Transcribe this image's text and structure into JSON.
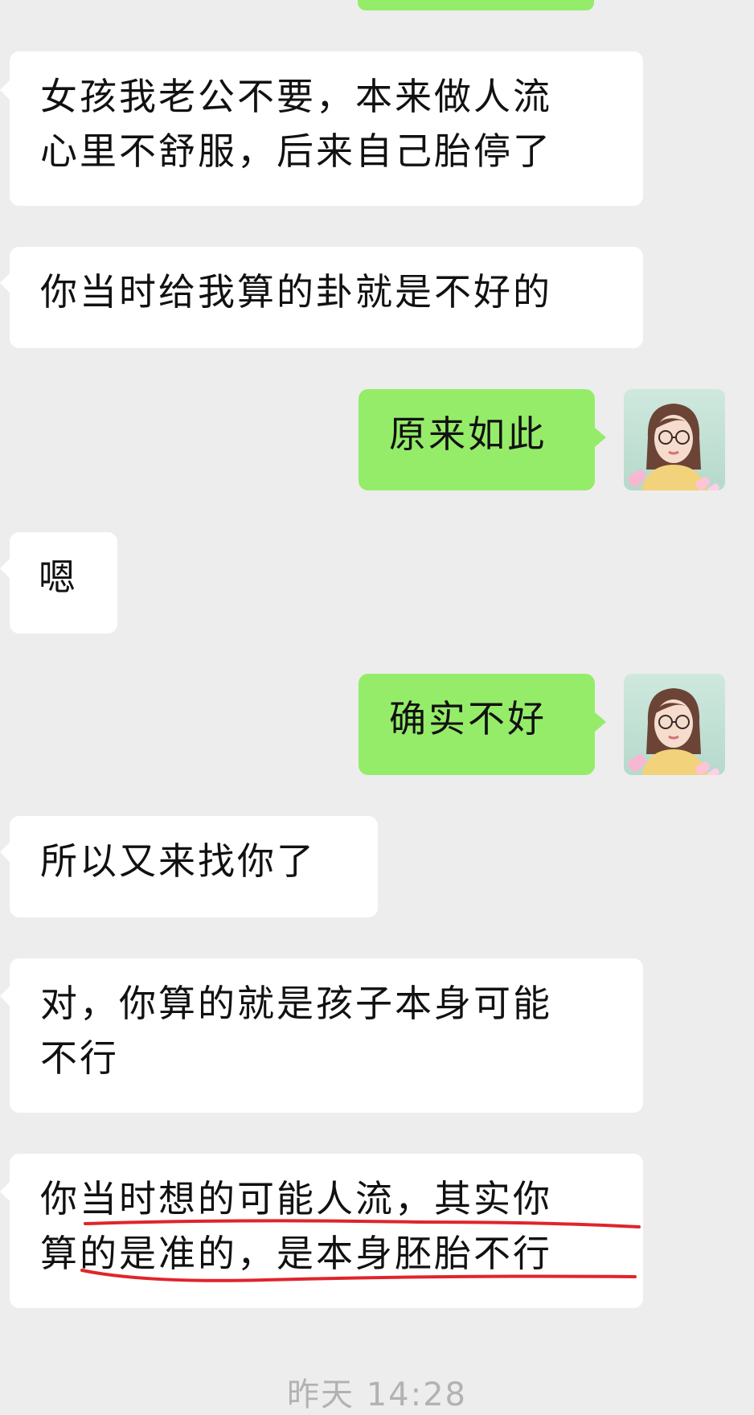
{
  "conversation": {
    "messages": [
      {
        "sender": "other",
        "text": "女孩我老公不要，本来做人流\n心里不舒服，后来自己胎停了"
      },
      {
        "sender": "other",
        "text": "你当时给我算的卦就是不好的"
      },
      {
        "sender": "me",
        "text": "原来如此"
      },
      {
        "sender": "other",
        "text": "嗯"
      },
      {
        "sender": "me",
        "text": "确实不好"
      },
      {
        "sender": "other",
        "text": "所以又来找你了"
      },
      {
        "sender": "other",
        "text": "对，你算的就是孩子本身可能\n不行"
      },
      {
        "sender": "other",
        "text": "你当时想的可能人流，其实你\n算的是准的，是本身胚胎不行"
      }
    ],
    "timestamp": "昨天 14:28"
  },
  "colors": {
    "background": "#ededed",
    "incoming_bubble": "#ffffff",
    "outgoing_bubble": "#95ec69",
    "annotation_underline": "#e0242b"
  },
  "icons": {
    "avatar": "user-avatar-illustration"
  }
}
